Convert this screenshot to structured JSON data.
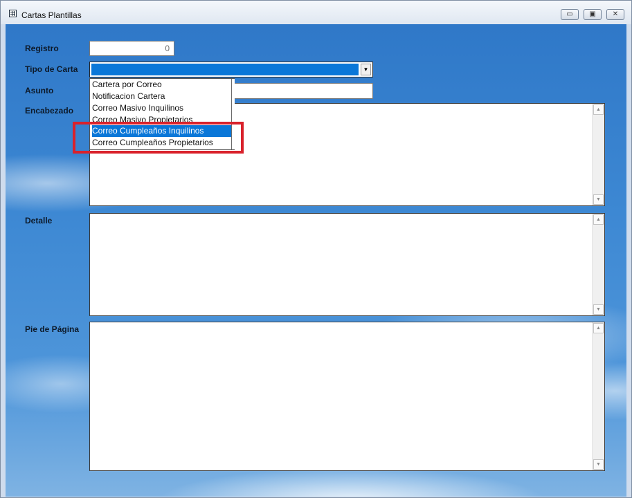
{
  "window": {
    "title": "Cartas Plantillas",
    "minimize_glyph": "▭",
    "maximize_glyph": "▣",
    "close_glyph": "✕"
  },
  "form": {
    "registro_label": "Registro",
    "registro_value": "0",
    "tipo_carta_label": "Tipo de Carta",
    "tipo_carta_value": "",
    "asunto_label": "Asunto",
    "encabezado_label": "Encabezado",
    "detalle_label": "Detalle",
    "pie_label": "Pie de Página"
  },
  "dropdown": {
    "options": [
      "Cartera por Correo",
      "Notificacion Cartera",
      "Correo Masivo Inquilinos",
      "Correo Masivo Propietarios",
      "Correo Cumpleaños Inquilinos",
      "Correo Cumpleaños Propietarios"
    ],
    "selected_index": 4
  },
  "colors": {
    "selection": "#0a77d8",
    "highlight_border": "#d9212b"
  }
}
